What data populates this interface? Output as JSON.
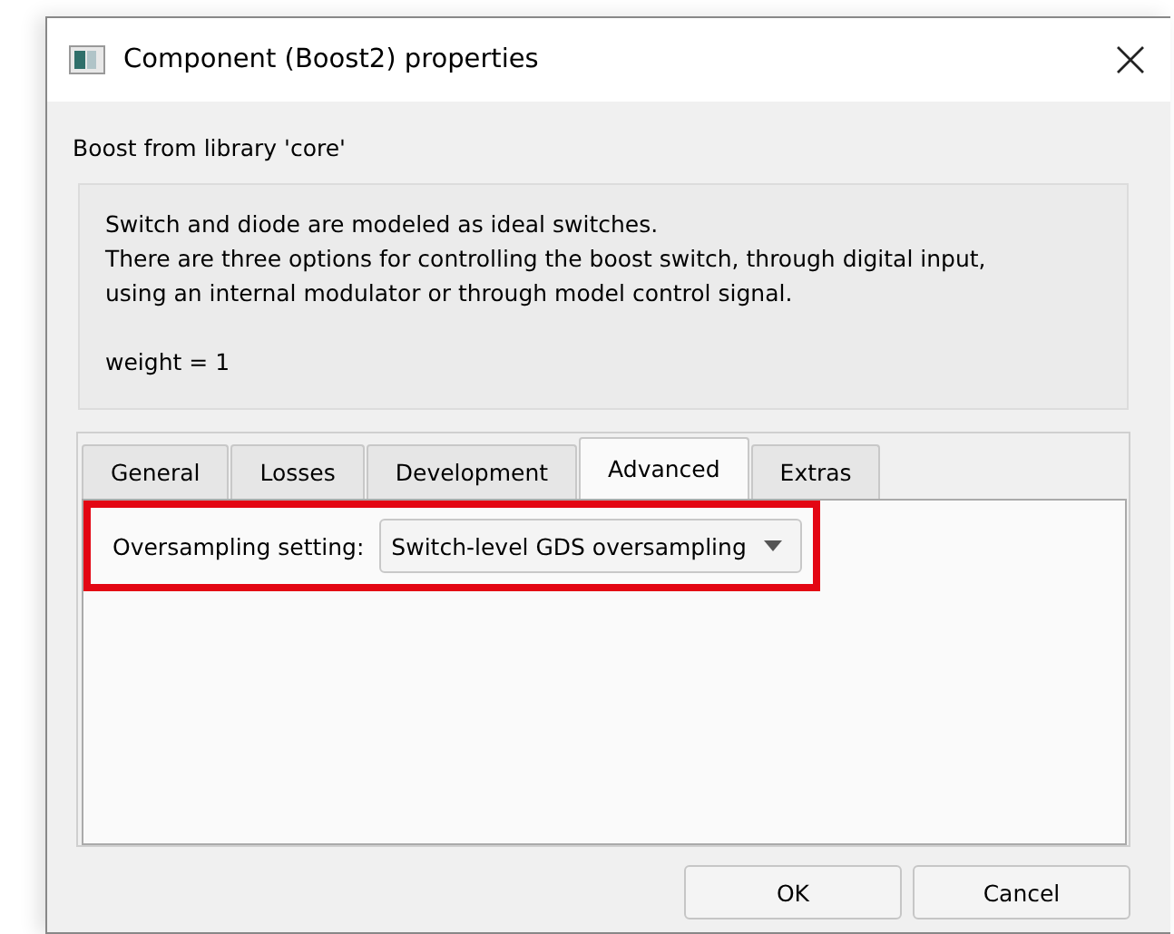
{
  "window": {
    "title": "Component (Boost2) properties"
  },
  "subtitle": "Boost from library 'core'",
  "description": [
    "Switch and diode are modeled as ideal switches.",
    "There are three options for controlling the boost switch, through digital input,",
    "using an internal modulator or through model control signal."
  ],
  "weight_note": "weight = 1",
  "tabs": [
    {
      "label": "General",
      "selected": false
    },
    {
      "label": "Losses",
      "selected": false
    },
    {
      "label": "Development",
      "selected": false
    },
    {
      "label": "Advanced",
      "selected": true
    },
    {
      "label": "Extras",
      "selected": false
    }
  ],
  "settings": [
    {
      "label": "Oversampling setting:",
      "value": "Switch-level GDS oversampling",
      "highlighted": true
    }
  ],
  "buttons": [
    "OK",
    "Cancel"
  ]
}
